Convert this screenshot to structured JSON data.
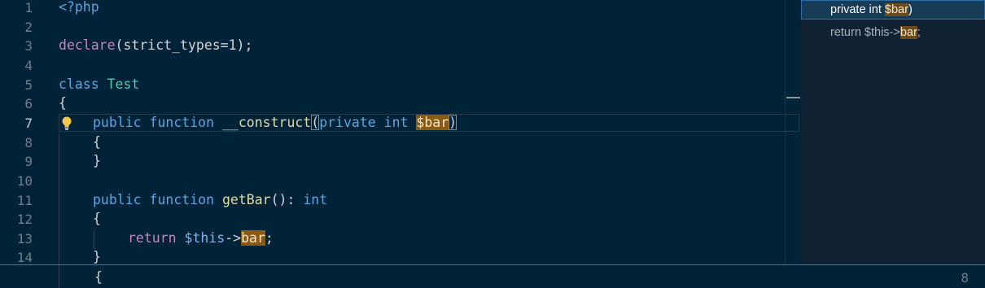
{
  "editor": {
    "line_numbers": [
      "1",
      "2",
      "3",
      "4",
      "5",
      "6",
      "7",
      "8",
      "9",
      "10",
      "11",
      "12",
      "13",
      "14"
    ],
    "active_line": "7",
    "lines": {
      "l1": "<?php",
      "l3_fn": "declare",
      "l3_rest": "(strict_types=1);",
      "l5_kw": "class",
      "l5_name": "Test",
      "l6": "{",
      "l7_kw1": "public",
      "l7_kw2": "function",
      "l7_name": "__construct",
      "l7_open": "(",
      "l7_mod": "private",
      "l7_type": "int",
      "l7_var": "$bar",
      "l7_close": ")",
      "l8": "{",
      "l9": "}",
      "l11_kw1": "public",
      "l11_kw2": "function",
      "l11_name": "getBar",
      "l11_rest": "(): ",
      "l11_type": "int",
      "l12": "{",
      "l13_kw": "return",
      "l13_this": "$this",
      "l13_arrow": "->",
      "l13_prop": "bar",
      "l13_semi": ";",
      "l14": "}"
    }
  },
  "peek": {
    "items": [
      {
        "prefix": "private int ",
        "match": "$bar",
        "suffix": ")"
      },
      {
        "prefix": "return $this->",
        "match": "bar",
        "suffix": ";"
      }
    ]
  },
  "bottom": {
    "line_number": "8",
    "code": "{"
  },
  "colors": {
    "background": "#012337",
    "highlight": "#8b5a12",
    "keyword": "#5aa5e6",
    "class_name": "#4ec9b0",
    "function_name": "#dcdcaa",
    "control": "#c586c0"
  },
  "icons": {
    "lightbulb": "lightbulb-icon"
  }
}
